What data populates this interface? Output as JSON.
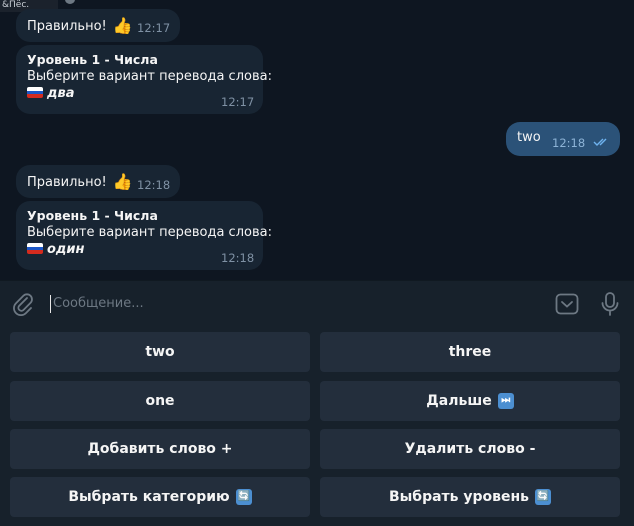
{
  "header_stub": "&Пёс.",
  "messages": [
    {
      "text": "Правильно!",
      "emoji": "👍",
      "time": "12:17"
    },
    {
      "title": "Уровень 1 - Числа",
      "prompt": "Выберите вариант перевода слова:",
      "word": "два",
      "time": "12:17"
    },
    {
      "text": "two",
      "time": "12:18",
      "outgoing": true
    },
    {
      "text": "Правильно!",
      "emoji": "👍",
      "time": "12:18"
    },
    {
      "title": "Уровень 1 - Числа",
      "prompt": "Выберите вариант перевода слова:",
      "word": "один",
      "time": "12:18"
    }
  ],
  "composer": {
    "placeholder": "Сообщение..."
  },
  "keyboard": {
    "rows": [
      [
        {
          "label": "two"
        },
        {
          "label": "three"
        }
      ],
      [
        {
          "label": "one"
        },
        {
          "label": "Дальше",
          "icon": "⏭"
        }
      ],
      [
        {
          "label": "Добавить слово +"
        },
        {
          "label": "Удалить слово -"
        }
      ],
      [
        {
          "label": "Выбрать категорию",
          "icon": "🔄"
        },
        {
          "label": "Выбрать уровень",
          "icon": "🔄"
        }
      ]
    ]
  },
  "colors": {
    "background": "#0e1621",
    "incoming": "#182533",
    "outgoing": "#2b5278",
    "button": "#232e3c",
    "accent": "#4c8fd1"
  },
  "icons": [
    "paperclip-icon",
    "emoji-panel-icon",
    "microphone-icon",
    "double-check-icon",
    "russian-flag-icon"
  ]
}
